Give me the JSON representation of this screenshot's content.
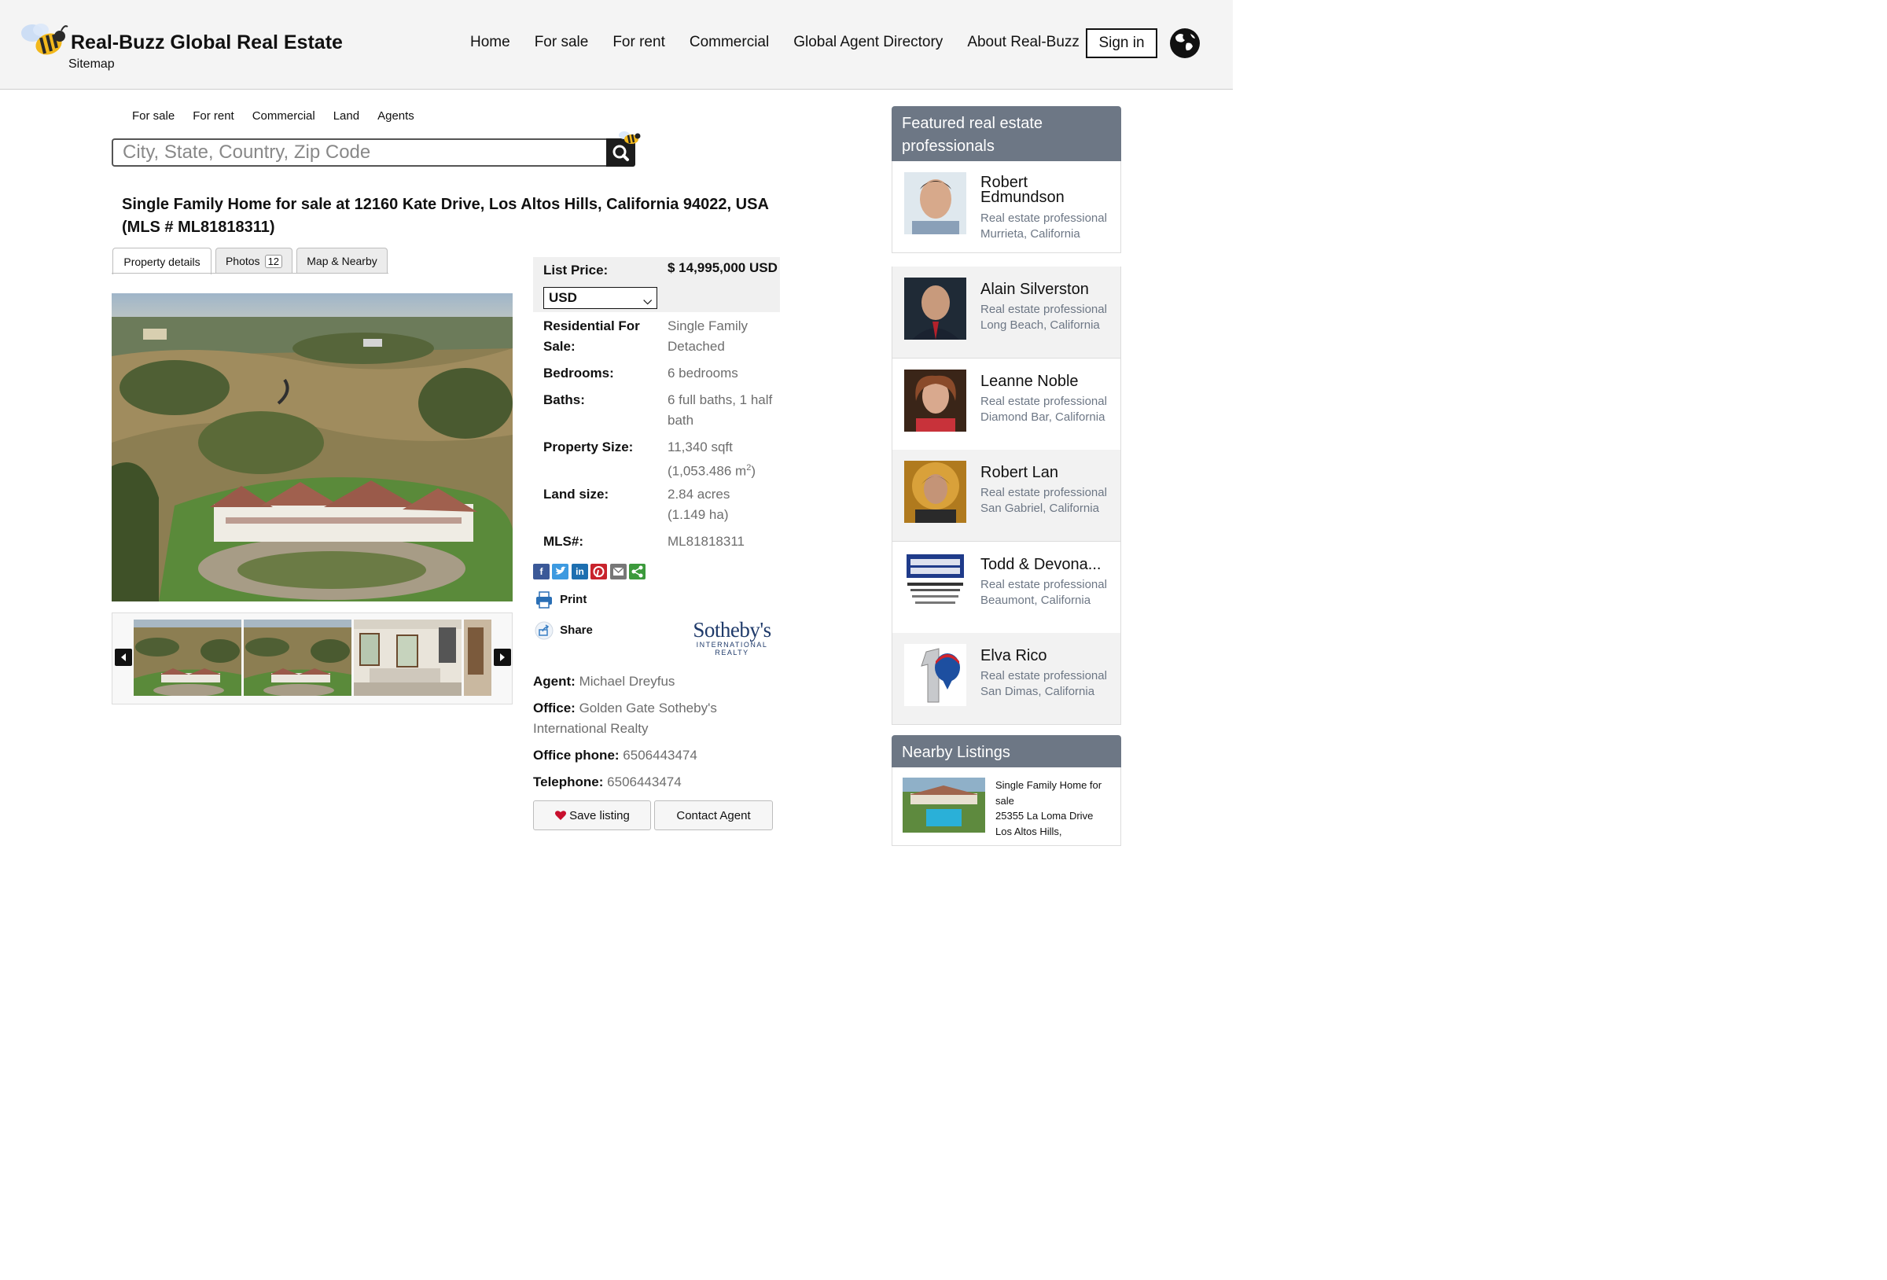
{
  "header": {
    "brand": "Real-Buzz Global Real Estate",
    "sitemap": "Sitemap",
    "nav": [
      "Home",
      "For sale",
      "For rent",
      "Commercial",
      "Global Agent Directory",
      "About Real-Buzz"
    ],
    "signin": "Sign in"
  },
  "search": {
    "tabs": [
      "For sale",
      "For rent",
      "Commercial",
      "Land",
      "Agents"
    ],
    "placeholder": "City, State, Country, Zip Code"
  },
  "listing": {
    "title": "Single Family Home for sale at 12160 Kate Drive, Los Altos Hills, California 94022, USA (MLS # ML81818311)",
    "tabs": {
      "details": "Property details",
      "photos": "Photos",
      "photos_count": "12",
      "map": "Map & Nearby"
    },
    "list_price_label": "List Price:",
    "list_price": "$ 14,995,000 USD",
    "currency": "USD",
    "type_label": "Residential For Sale:",
    "type_value": "Single Family Detached",
    "bedrooms_label": "Bedrooms:",
    "bedrooms": "6 bedrooms",
    "baths_label": "Baths:",
    "baths": "6 full baths, 1 half bath",
    "size_label": "Property Size:",
    "size_sqft": "11,340 sqft",
    "size_m2": "(1,053.486 m",
    "size_m2_sup": "2",
    "size_m2_close": ")",
    "land_label": "Land size:",
    "land_acres": "2.84 acres",
    "land_ha": "(1.149 ha)",
    "mls_label": "MLS#:",
    "mls": "ML81818311",
    "print": "Print",
    "share": "Share",
    "broker_logo_big": "Sotheby's",
    "broker_logo_small": "INTERNATIONAL REALTY",
    "agent_label": "Agent:",
    "agent": "Michael Dreyfus",
    "office_label": "Office:",
    "office": "Golden Gate Sotheby's International Realty",
    "office_phone_label": "Office phone:",
    "office_phone": "6506443474",
    "telephone_label": "Telephone:",
    "telephone": "6506443474",
    "save": "Save listing",
    "contact": "Contact Agent"
  },
  "sidebar": {
    "featured_title": "Featured real estate professionals",
    "agents": [
      {
        "name": "Robert Edmundson",
        "role": "Real estate professional",
        "location": "Murrieta, California"
      },
      {
        "name": "Alain Silverston",
        "role": "Real estate professional",
        "location": "Long Beach, California"
      },
      {
        "name": "Leanne Noble",
        "role": "Real estate professional",
        "location": "Diamond Bar, California"
      },
      {
        "name": "Robert Lan",
        "role": "Real estate professional",
        "location": "San Gabriel, California"
      },
      {
        "name": "Todd & Devona...",
        "role": "Real estate professional",
        "location": "Beaumont, California"
      },
      {
        "name": "Elva Rico",
        "role": "Real estate professional",
        "location": "San Dimas, California"
      }
    ],
    "nearby_title": "Nearby Listings",
    "nearby": {
      "type": "Single Family Home for sale",
      "address": "25355 La Loma Drive",
      "city": "Los Altos Hills,"
    }
  },
  "colors": {
    "sidebar_header": "#6d7785",
    "heart": "#c8102e",
    "sothebys_blue": "#1f3a6a"
  },
  "icons": [
    "bee-logo-icon",
    "globe-icon",
    "search-icon",
    "facebook-icon",
    "twitter-icon",
    "linkedin-icon",
    "pinterest-icon",
    "email-icon",
    "share-icon",
    "printer-icon",
    "heart-icon",
    "prev-arrow-icon",
    "next-arrow-icon"
  ]
}
